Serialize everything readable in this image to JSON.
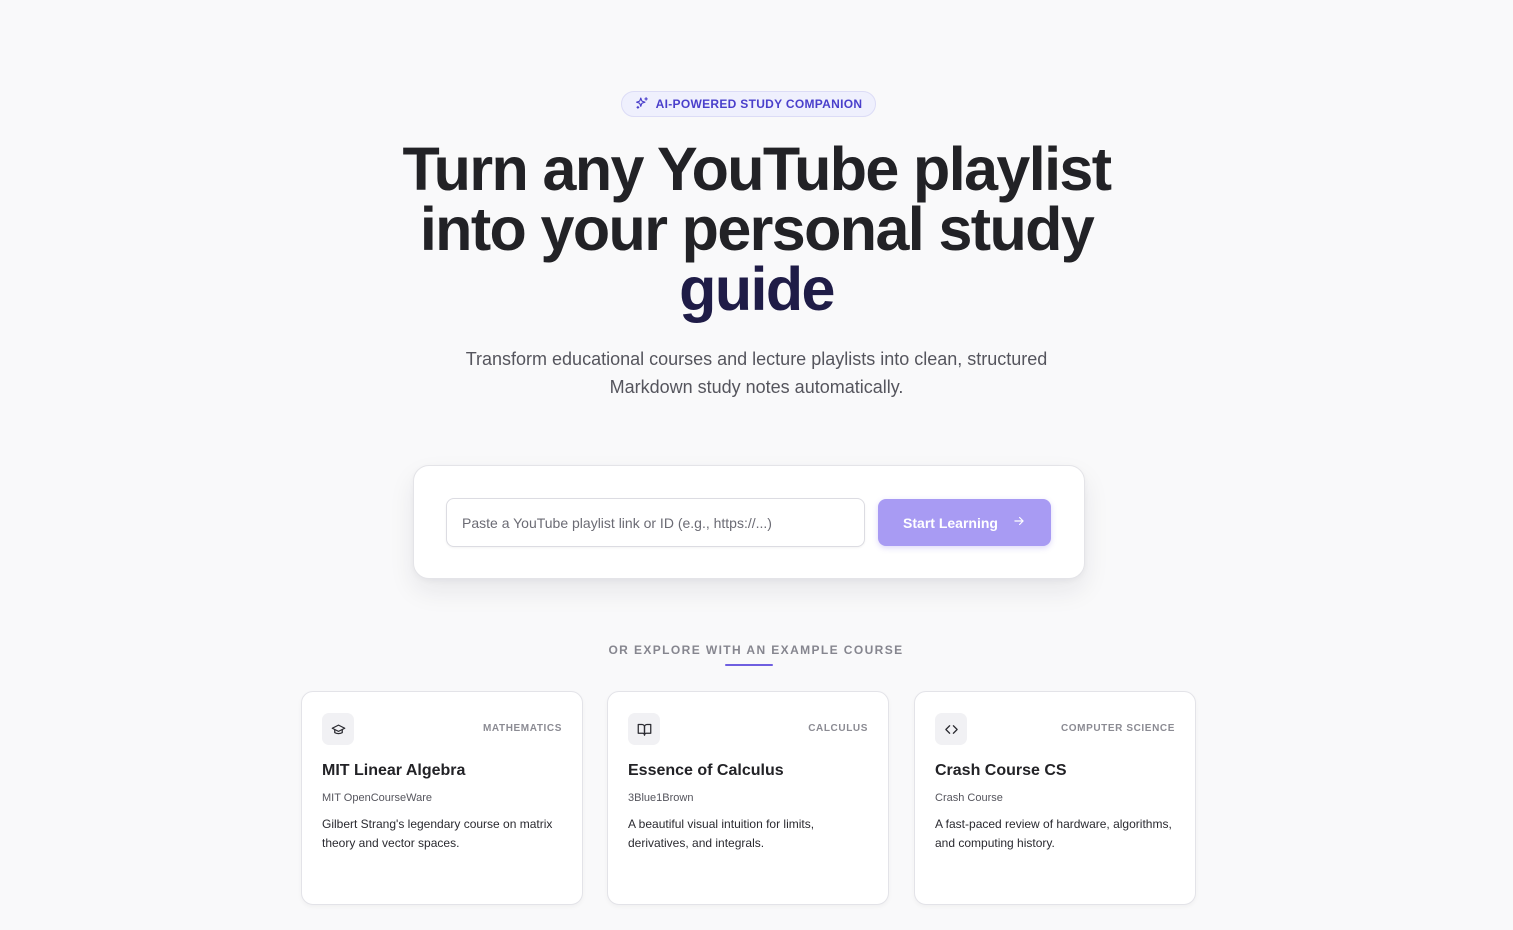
{
  "badge": {
    "label": "AI-POWERED STUDY COMPANION",
    "icon": "sparkles-icon"
  },
  "hero": {
    "title_line1": "Turn any YouTube playlist",
    "title_line2": "into your personal study",
    "title_accent": "guide",
    "subtitle_line1": "Transform educational courses and lecture playlists into clean, structured",
    "subtitle_line2": "Markdown study notes automatically."
  },
  "input": {
    "placeholder": "Paste a YouTube playlist link or ID (e.g., https://...)",
    "value": ""
  },
  "button": {
    "label": "Start Learning",
    "icon": "arrow-right-icon"
  },
  "explore": {
    "label": "OR EXPLORE WITH AN EXAMPLE COURSE"
  },
  "courses": [
    {
      "icon": "graduation-cap-icon",
      "category": "MATHEMATICS",
      "title": "MIT Linear Algebra",
      "author": "MIT OpenCourseWare",
      "description": "Gilbert Strang's legendary course on matrix theory and vector spaces."
    },
    {
      "icon": "book-open-icon",
      "category": "CALCULUS",
      "title": "Essence of Calculus",
      "author": "3Blue1Brown",
      "description": "A beautiful visual intuition for limits, derivatives, and integrals."
    },
    {
      "icon": "code-icon",
      "category": "COMPUTER SCIENCE",
      "title": "Crash Course CS",
      "author": "Crash Course",
      "description": "A fast-paced review of hardware, algorithms, and computing history."
    }
  ],
  "colors": {
    "background": "#f9f9fa",
    "accent": "#4a3fcb",
    "button": "#a89bf3",
    "title_accent": "#1f1c47"
  }
}
